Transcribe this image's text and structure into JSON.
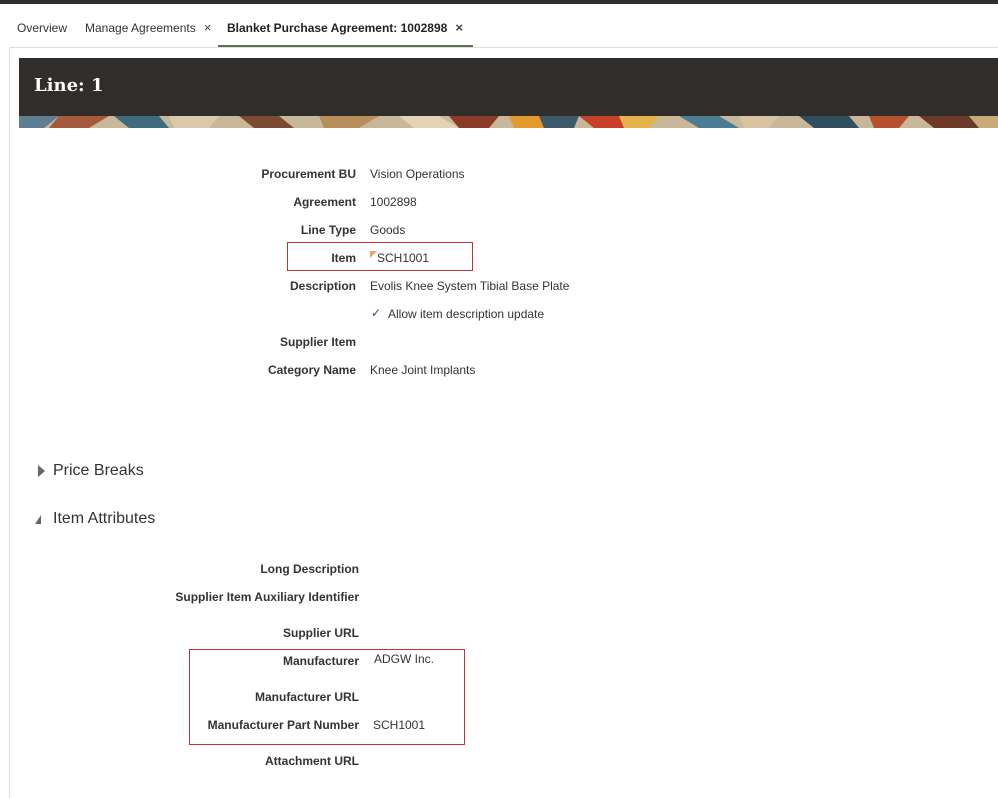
{
  "tabs": [
    {
      "label": "Overview"
    },
    {
      "label": "Manage Agreements",
      "close": "×"
    },
    {
      "label": "Blanket Purchase Agreement: 1002898",
      "close": "×"
    }
  ],
  "header": {
    "title": "Line: 1"
  },
  "line_details": {
    "procurement_bu": {
      "label": "Procurement BU",
      "value": "Vision Operations"
    },
    "agreement": {
      "label": "Agreement",
      "value": "1002898"
    },
    "line_type": {
      "label": "Line Type",
      "value": "Goods"
    },
    "item": {
      "label": "Item",
      "value": "SCH1001"
    },
    "description": {
      "label": "Description",
      "value": "Evolis Knee System Tibial Base Plate"
    },
    "allow_update": {
      "label": "Allow item description update",
      "checked": true
    },
    "supplier_item": {
      "label": "Supplier Item",
      "value": ""
    },
    "category_name": {
      "label": "Category Name",
      "value": "Knee Joint Implants"
    }
  },
  "sections": {
    "price_breaks": {
      "label": "Price Breaks",
      "expanded": false
    },
    "item_attributes": {
      "label": "Item Attributes",
      "expanded": true
    }
  },
  "item_attributes": {
    "long_description": {
      "label": "Long Description",
      "value": ""
    },
    "supplier_aux_id": {
      "label": "Supplier Item Auxiliary Identifier",
      "value": ""
    },
    "supplier_url": {
      "label": "Supplier URL",
      "value": ""
    },
    "manufacturer": {
      "label": "Manufacturer",
      "value": "ADGW Inc."
    },
    "manufacturer_url": {
      "label": "Manufacturer URL",
      "value": ""
    },
    "manufacturer_part_number": {
      "label": "Manufacturer Part Number",
      "value": "SCH1001"
    },
    "attachment_url": {
      "label": "Attachment URL",
      "value": ""
    }
  },
  "colors": {
    "banner": "#312d2a",
    "tab_underline": "#5c7151",
    "highlight_box": "#c4303a",
    "checkmark": "#2b4a7a"
  },
  "icons": [
    "close-icon",
    "checkmark-icon",
    "expand-triangle-icon",
    "collapse-triangle-icon"
  ]
}
